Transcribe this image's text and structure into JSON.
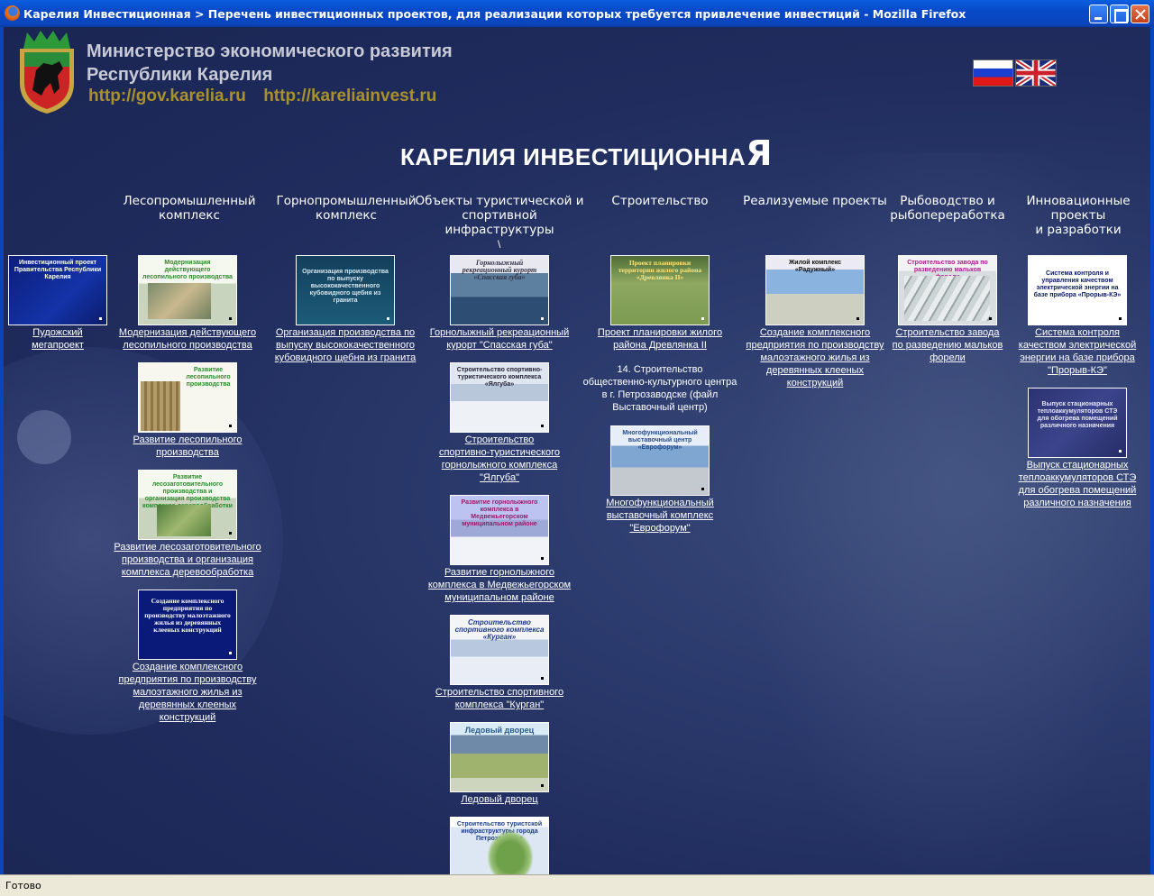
{
  "window": {
    "title": "Карелия Инвестиционная > Перечень инвестиционных проектов, для реализации которых требуется привлечение инвестиций - Mozilla Firefox",
    "status": "Готово"
  },
  "header": {
    "ministry_line1": "Министерство экономического развития",
    "ministry_line2": "Республики Карелия",
    "url1": "http://gov.karelia.ru",
    "url2": "http://kareliainvest.ru",
    "site_title_main": "КАРЕЛИЯ ИНВЕСТИЦИОННА",
    "site_title_last": "Я"
  },
  "categories": {
    "forest_1": "Лесопромышленный",
    "forest_2": "комплекс",
    "mining_1": "Горнопромышленный",
    "mining_2": "комплекс",
    "tourism_1": "Объекты туристической и",
    "tourism_2": "спортивной инфраструктуры",
    "construction_1": "Строительство",
    "realized_1": "Реализуемые проекты",
    "fishing_1": "Рыбоводство и",
    "fishing_2": "рыбопереработка",
    "innovation_1": "Инновационные проекты",
    "innovation_2": "и разработки"
  },
  "backslash": "\\",
  "items": {
    "pudozh": {
      "thumb": "Инвестиционный проект Правительства Республики Карелия",
      "caption_1": "Пудожский",
      "caption_2": "мегапроект"
    },
    "sawmill_modern": {
      "thumb": "Модернизация действующего лесопильного производства",
      "caption_1": "Модернизация действующего",
      "caption_2": "лесопильного производства"
    },
    "sawmill_dev": {
      "thumb": "Развитие лесопильного производства",
      "caption_1": "Развитие лесопильного",
      "caption_2": "производства"
    },
    "logging": {
      "thumb": "Развитие лесозаготовительного производства и организация производства комплекса деревообработки",
      "caption_1": "Развитие лесозаготовительного",
      "caption_2": "производства и организация",
      "caption_3": "комплекса деревообработка"
    },
    "lowrise_forest": {
      "thumb": "Создание комплексного предприятия по производству малоэтажного жилья из деревянных клееных конструкций",
      "caption_1": "Создание комплексного",
      "caption_2": "предприятия по производству",
      "caption_3": "малоэтажного жилья из",
      "caption_4": "деревянных клееных",
      "caption_5": "конструкций"
    },
    "granite": {
      "thumb": "Организация производства по выпуску высококачественного кубовидного щебня из гранита",
      "caption_1": "Организация производства по",
      "caption_2": "выпуску высококачественного",
      "caption_3": "кубовидного щебня из гранита"
    },
    "spasskaya": {
      "thumb": "Горнолыжный рекреационный курорт «Спасская губа»",
      "caption_1": "Горнолыжный рекреационный",
      "caption_2": "курорт \"Спасская губа\""
    },
    "yalguba": {
      "thumb": "Строительство спортивно-туристического комплекса «Ялгуба»",
      "caption_1": "Строительство",
      "caption_2": "спортивно-туристического",
      "caption_3": "горнолыжного комплекса",
      "caption_4": "\"Ялгуба\""
    },
    "medvezh": {
      "thumb": "Развитие горнолыжного комплекса в Медвежьегорском муниципальном районе",
      "caption_1": "Развитие горнолыжного",
      "caption_2": "комплекса в Медвежьегорском",
      "caption_3": "муниципальном районе"
    },
    "kurgan": {
      "thumb": "Строительство спортивного комплекса «Курган»",
      "caption_1": "Строительство спортивного",
      "caption_2": "комплекса \"Курган\""
    },
    "ice_palace": {
      "thumb": "Ледовый дворец",
      "caption_1": "Ледовый дворец"
    },
    "tourist_infra": {
      "thumb": "Строительство туристской инфраструктуры города Петрозаводска"
    },
    "drevlyanka": {
      "thumb": "Проект планировки территории жилого района «Древлянка II»",
      "caption_1": "Проект планировки жилого",
      "caption_2": "района Древлянка II"
    },
    "note_center_1": "14. Строительство",
    "note_center_2": "общественно-культурного центра",
    "note_center_3": "в г. Петрозаводске (файл",
    "note_center_4": "Выставочный центр)",
    "euroforum": {
      "thumb": "Многофункциональный выставочный центр «Еврофорум»",
      "caption_1": "Многофункциональный",
      "caption_2": "выставочный комплекс",
      "caption_3": "\"Еврофорум\""
    },
    "raduzhny": {
      "thumb": "Жилой комплекс «Радужный»",
      "caption_1": "Создание комплексного",
      "caption_2": "предприятия по производству",
      "caption_3": "малоэтажного жилья из",
      "caption_4": "деревянных клееных",
      "caption_5": "конструкций"
    },
    "trout": {
      "thumb": "Строительство завода по разведению мальков форели",
      "caption_1": "Строительство завода",
      "caption_2": "по разведению мальков",
      "caption_3": "форели"
    },
    "proryv": {
      "thumb": "Система контроля и управления качеством электрической энергии на базе прибора «Прорыв-КЭ»",
      "caption_1": "Система контроля",
      "caption_2": "качеством электрической",
      "caption_3": "энергии на базе прибора",
      "caption_4": "\"Прорыв-КЭ\""
    },
    "heat": {
      "thumb": "Выпуск стационарных теплоаккумуляторов СТЭ для обогрева помещений различного назначения",
      "caption_1": "Выпуск стационарных",
      "caption_2": "теплоаккумуляторов СТЭ",
      "caption_3": "для обогрева помещений",
      "caption_4": "различного назначения"
    }
  }
}
